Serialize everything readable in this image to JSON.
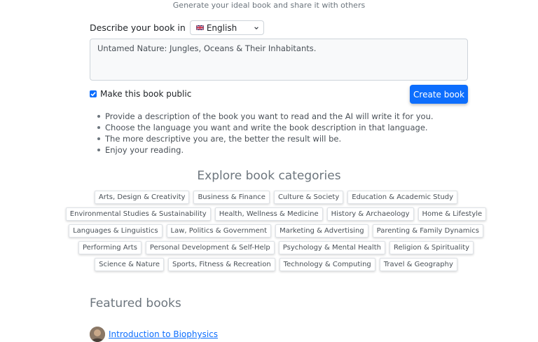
{
  "header": {
    "subtitle": "Generate your ideal book and share it with others"
  },
  "form": {
    "language_label": "Describe your book in",
    "language_selected": "English",
    "language_flag_icon": "uk-flag-icon",
    "description_value": "Untamed Nature: Jungles, Oceans & Their Inhabitants.",
    "public_label": "Make this book public",
    "public_checked": true,
    "create_button": "Create book"
  },
  "tips": [
    "Provide a description of the book you want to read and the AI will write it for you.",
    "Choose the language you want and write the book description in that language.",
    "The more descriptive you are, the better the result will be.",
    "Enjoy your reading."
  ],
  "categories": {
    "title": "Explore book categories",
    "rows": [
      [
        "Arts, Design & Creativity",
        "Business & Finance",
        "Culture & Society",
        "Education & Academic Study"
      ],
      [
        "Environmental Studies & Sustainability",
        "Health, Wellness & Medicine",
        "History & Archaeology",
        "Home & Lifestyle"
      ],
      [
        "Languages & Linguistics",
        "Law, Politics & Government",
        "Marketing & Advertising",
        "Parenting & Family Dynamics"
      ],
      [
        "Performing Arts",
        "Personal Development & Self-Help",
        "Psychology & Mental Health",
        "Religion & Spirituality"
      ],
      [
        "Science & Nature",
        "Sports, Fitness & Recreation",
        "Technology & Computing",
        "Travel & Geography"
      ]
    ]
  },
  "featured": {
    "title": "Featured books",
    "books": [
      {
        "title": "Introduction to Biophysics"
      }
    ]
  },
  "colors": {
    "accent": "#0d6efd",
    "muted": "#6c757d"
  }
}
